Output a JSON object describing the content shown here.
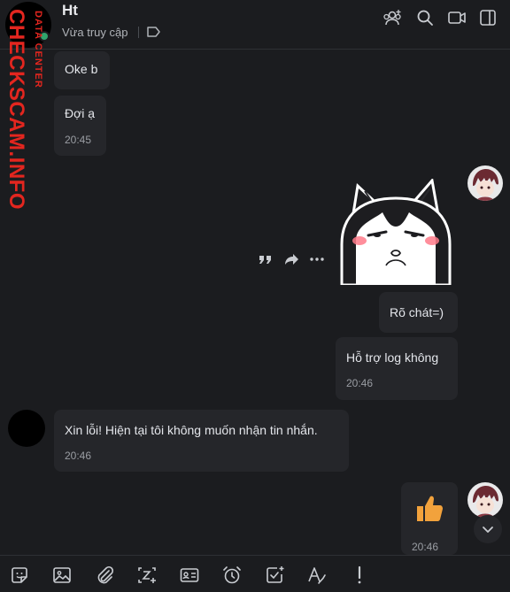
{
  "header": {
    "name": "Ht",
    "status": "Vừa truy cập"
  },
  "watermark": {
    "main": "CHECKSCAM.INFO",
    "sub": "DATA CENTER"
  },
  "messages": {
    "m1": {
      "text": "Oke b"
    },
    "m2": {
      "text": "Đợi ạ",
      "time": "20:45"
    },
    "m3": {
      "text": "Rõ chát=)"
    },
    "m4": {
      "text": "Hỗ trợ log không",
      "time": "20:46"
    },
    "m5": {
      "text": "Xin lỗi! Hiện tại tôi không muốn nhận tin nhắn.",
      "time": "20:46"
    },
    "m6": {
      "time": "20:46"
    }
  },
  "icons": {
    "header": [
      "add-group-icon",
      "search-icon",
      "video-call-icon",
      "sidebar-toggle-icon"
    ],
    "tag": "tag-icon",
    "message_actions": [
      "quote-icon",
      "forward-icon",
      "more-icon"
    ],
    "toolbar": [
      "sticker-icon",
      "image-icon",
      "attachment-icon",
      "auto-resize-icon",
      "contact-card-icon",
      "reminder-icon",
      "task-icon",
      "text-format-icon",
      "urgent-icon"
    ],
    "scroll": "chevron-down-icon"
  },
  "colors": {
    "background": "#1b1c1f",
    "bubble": "#25262a",
    "watermark": "#e3261f",
    "online": "#30a46c",
    "like": "#f2a23c"
  }
}
